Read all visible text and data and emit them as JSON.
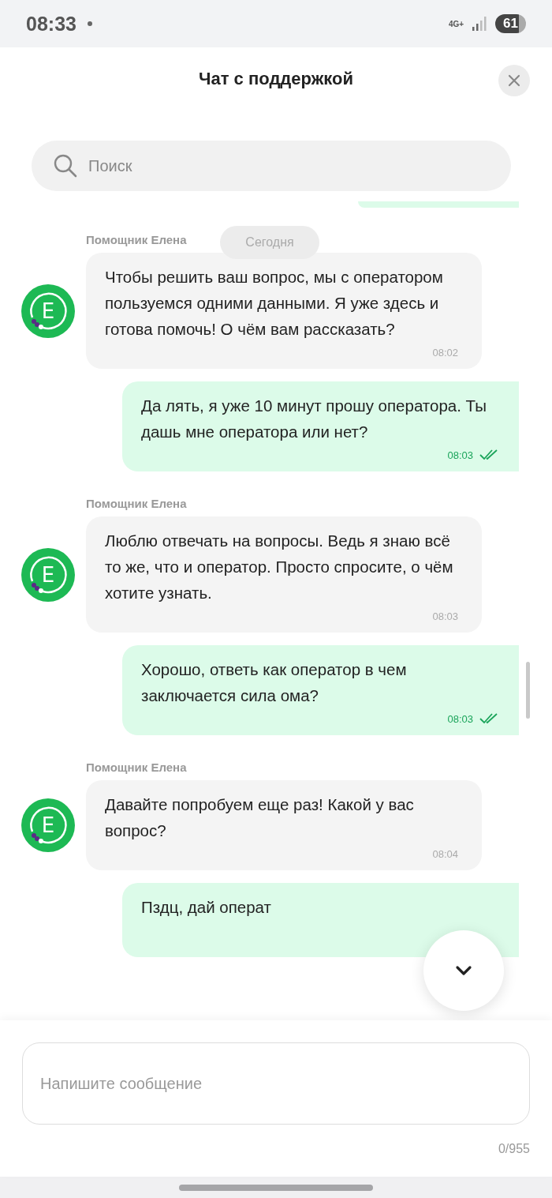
{
  "status_bar": {
    "time": "08:33",
    "network": "4G+",
    "battery": "61"
  },
  "header": {
    "title": "Чат с поддержкой"
  },
  "search": {
    "placeholder": "Поиск"
  },
  "date_chip": "Сегодня",
  "messages": [
    {
      "kind": "bot",
      "sender": "Помощник Елена",
      "avatar": "E",
      "text": "Чтобы решить ваш вопрос, мы с оператором пользуемся одними данными. Я уже здесь и готова помочь! О чём вам рассказать?",
      "time": "08:02"
    },
    {
      "kind": "user",
      "text": "Да лять, я уже 10 минут прошу оператора. Ты дашь мне оператора или нет?",
      "time": "08:03",
      "read": true
    },
    {
      "kind": "bot",
      "sender": "Помощник Елена",
      "avatar": "E",
      "text": "Люблю отвечать на вопросы. Ведь я знаю всё то же, что и оператор. Просто спросите, о чём хотите узнать.",
      "time": "08:03"
    },
    {
      "kind": "user",
      "text": "Хорошо, ответь как оператор в чем заключается сила ома?",
      "time": "08:03",
      "read": true
    },
    {
      "kind": "bot",
      "sender": "Помощник Елена",
      "avatar": "E",
      "text": "Давайте попробуем еще раз! Какой у вас вопрос?",
      "time": "08:04"
    },
    {
      "kind": "user",
      "text": "Пздц, дай операт"
    }
  ],
  "composer": {
    "placeholder": "Напишите сообщение",
    "counter": "0/955"
  }
}
